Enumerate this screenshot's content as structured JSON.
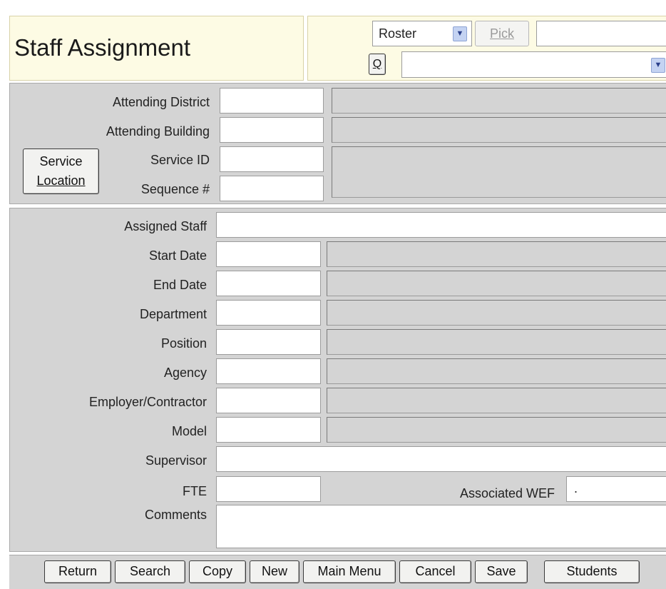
{
  "header": {
    "title": "Staff Assignment",
    "roster_select_value": "Roster",
    "pick_button": "Pick",
    "pick_input_value": "",
    "q_button": "Q",
    "query_select_value": ""
  },
  "service_location": {
    "button_line1": "Service",
    "button_line2": "Location",
    "labels": {
      "attending_district": "Attending District",
      "attending_building": "Attending Building",
      "service_id": "Service ID",
      "sequence": "Sequence #"
    }
  },
  "assignment": {
    "labels": {
      "assigned_staff": "Assigned Staff",
      "start_date": "Start Date",
      "end_date": "End Date",
      "department": "Department",
      "position": "Position",
      "agency": "Agency",
      "employer_contractor": "Employer/Contractor",
      "model": "Model",
      "supervisor": "Supervisor",
      "fte": "FTE",
      "associated_wef": "Associated WEF",
      "comments": "Comments"
    },
    "associated_wef_value": "."
  },
  "footer": {
    "buttons": [
      "Return",
      "Search",
      "Copy",
      "New",
      "Main Menu",
      "Cancel",
      "Save",
      "Students"
    ]
  },
  "colors": {
    "panel_bg": "#d4d4d4",
    "header_bg": "#fdfbe4",
    "select_arrow": "#c4d3f2"
  },
  "icons": {
    "dropdown": "chevron-down-icon"
  }
}
